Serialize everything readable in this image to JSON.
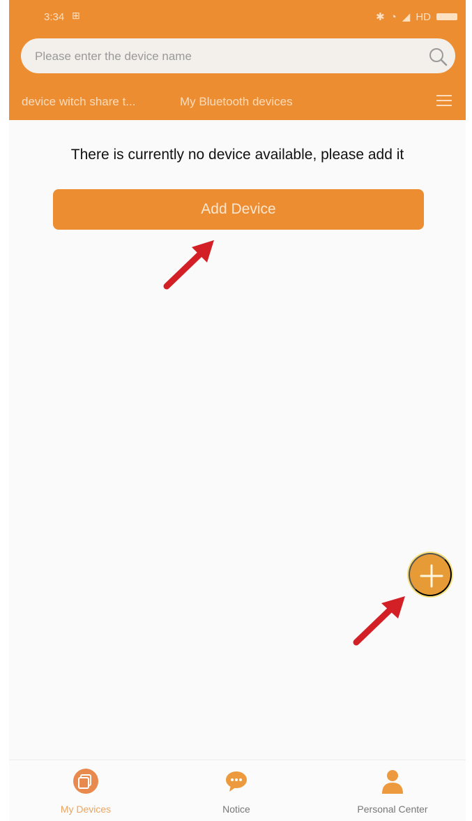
{
  "status_bar": {
    "time": "3:34",
    "notification": "⊞",
    "network": "HD"
  },
  "search": {
    "placeholder": "Please enter the device name"
  },
  "tabs": [
    {
      "label": "device witch share t..."
    },
    {
      "label": "My Bluetooth devices"
    }
  ],
  "main": {
    "empty_message": "There is currently no device available, please add it",
    "add_button_label": "Add Device"
  },
  "bottom_nav": [
    {
      "label": "My Devices",
      "icon": "devices-icon",
      "active": true
    },
    {
      "label": "Notice",
      "icon": "chat-bubble-icon",
      "active": false
    },
    {
      "label": "Personal Center",
      "icon": "person-icon",
      "active": false
    }
  ],
  "colors": {
    "brand_orange": "#ec8d32",
    "annotation_arrow": "#d32027",
    "background": "#fafafa"
  }
}
